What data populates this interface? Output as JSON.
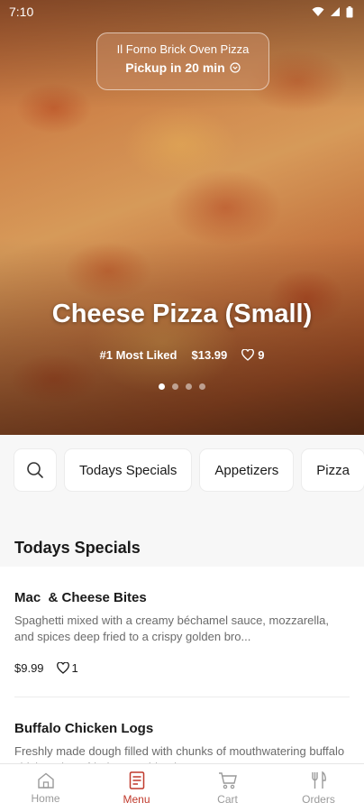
{
  "status_bar": {
    "time": "7:10"
  },
  "hero": {
    "store_name": "Il Forno Brick Oven Pizza",
    "pickup": "Pickup in 20 min",
    "title": "Cheese Pizza (Small)",
    "badge": "#1 Most Liked",
    "price": "$13.99",
    "likes": "9",
    "carousel_pages": 4,
    "carousel_active": 1
  },
  "categories": {
    "items": [
      {
        "label": "Todays Specials"
      },
      {
        "label": "Appetizers"
      },
      {
        "label": "Pizza"
      }
    ]
  },
  "section": {
    "title": "Todays Specials"
  },
  "items": [
    {
      "name": "Mac  & Cheese Bites",
      "description": "Spaghetti mixed with a creamy béchamel sauce, mozzarella, and spices deep fried to a crispy golden bro...",
      "price": "$9.99",
      "likes": "1"
    },
    {
      "name": "Buffalo Chicken Logs",
      "description": "Freshly made dough filled with chunks of mouthwatering buffalo chicken deep fried to a golden brown.",
      "price": "",
      "likes": ""
    }
  ],
  "nav": {
    "items": [
      {
        "label": "Home",
        "icon": "home-icon"
      },
      {
        "label": "Menu",
        "icon": "menu-icon",
        "active": true
      },
      {
        "label": "Cart",
        "icon": "cart-icon"
      },
      {
        "label": "Orders",
        "icon": "orders-icon"
      }
    ]
  },
  "colors": {
    "accent": "#c0392b"
  }
}
